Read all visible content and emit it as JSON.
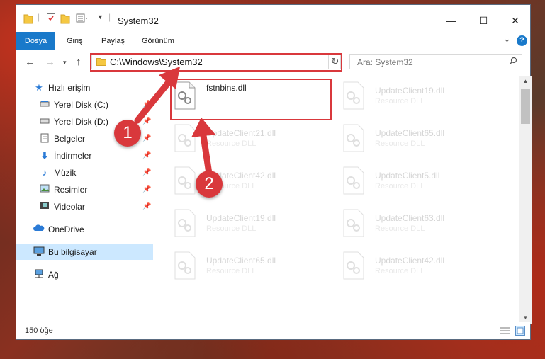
{
  "window": {
    "title": "System32",
    "controls": {
      "minimize": "—",
      "maximize": "☐",
      "close": "✕"
    }
  },
  "ribbon": {
    "tabs": [
      {
        "label": "Dosya"
      },
      {
        "label": "Giriş"
      },
      {
        "label": "Paylaş"
      },
      {
        "label": "Görünüm"
      }
    ],
    "help_glyph": "?",
    "expand_glyph": "⌄"
  },
  "navigation": {
    "address": "C:\\Windows\\System32",
    "search_placeholder": "Ara: System32"
  },
  "sidebar": {
    "items": [
      {
        "label": "Hızlı erişim"
      },
      {
        "label": "Yerel Disk (C:)"
      },
      {
        "label": "Yerel Disk (D:)"
      },
      {
        "label": "Belgeler"
      },
      {
        "label": "İndirmeler"
      },
      {
        "label": "Müzik"
      },
      {
        "label": "Resimler"
      },
      {
        "label": "Videolar"
      },
      {
        "label": "OneDrive"
      },
      {
        "label": "Bu bilgisayar"
      },
      {
        "label": "Ağ"
      }
    ]
  },
  "files": {
    "highlighted": {
      "name": "fstnbins.dll",
      "type": ""
    },
    "left_column": [
      {
        "name": "UpdateClient21.dll",
        "type": "Resource DLL"
      },
      {
        "name": "UpdateClient42.dll",
        "type": "Resource DLL"
      },
      {
        "name": "UpdateClient19.dll",
        "type": "Resource DLL"
      },
      {
        "name": "UpdateClient65.dll",
        "type": "Resource DLL"
      }
    ],
    "right_column": [
      {
        "name": "UpdateClient19.dll",
        "type": "Resource DLL"
      },
      {
        "name": "UpdateClient65.dll",
        "type": "Resource DLL"
      },
      {
        "name": "UpdateClient5.dll",
        "type": "Resource DLL"
      },
      {
        "name": "UpdateClient63.dll",
        "type": "Resource DLL"
      },
      {
        "name": "UpdateClient42.dll",
        "type": "Resource DLL"
      }
    ]
  },
  "status": {
    "item_count": "150 öğe"
  },
  "callouts": {
    "step1": "1",
    "step2": "2"
  },
  "colors": {
    "accent": "#1979ca",
    "callout_red": "#d9383c",
    "selection": "#cce8ff"
  }
}
